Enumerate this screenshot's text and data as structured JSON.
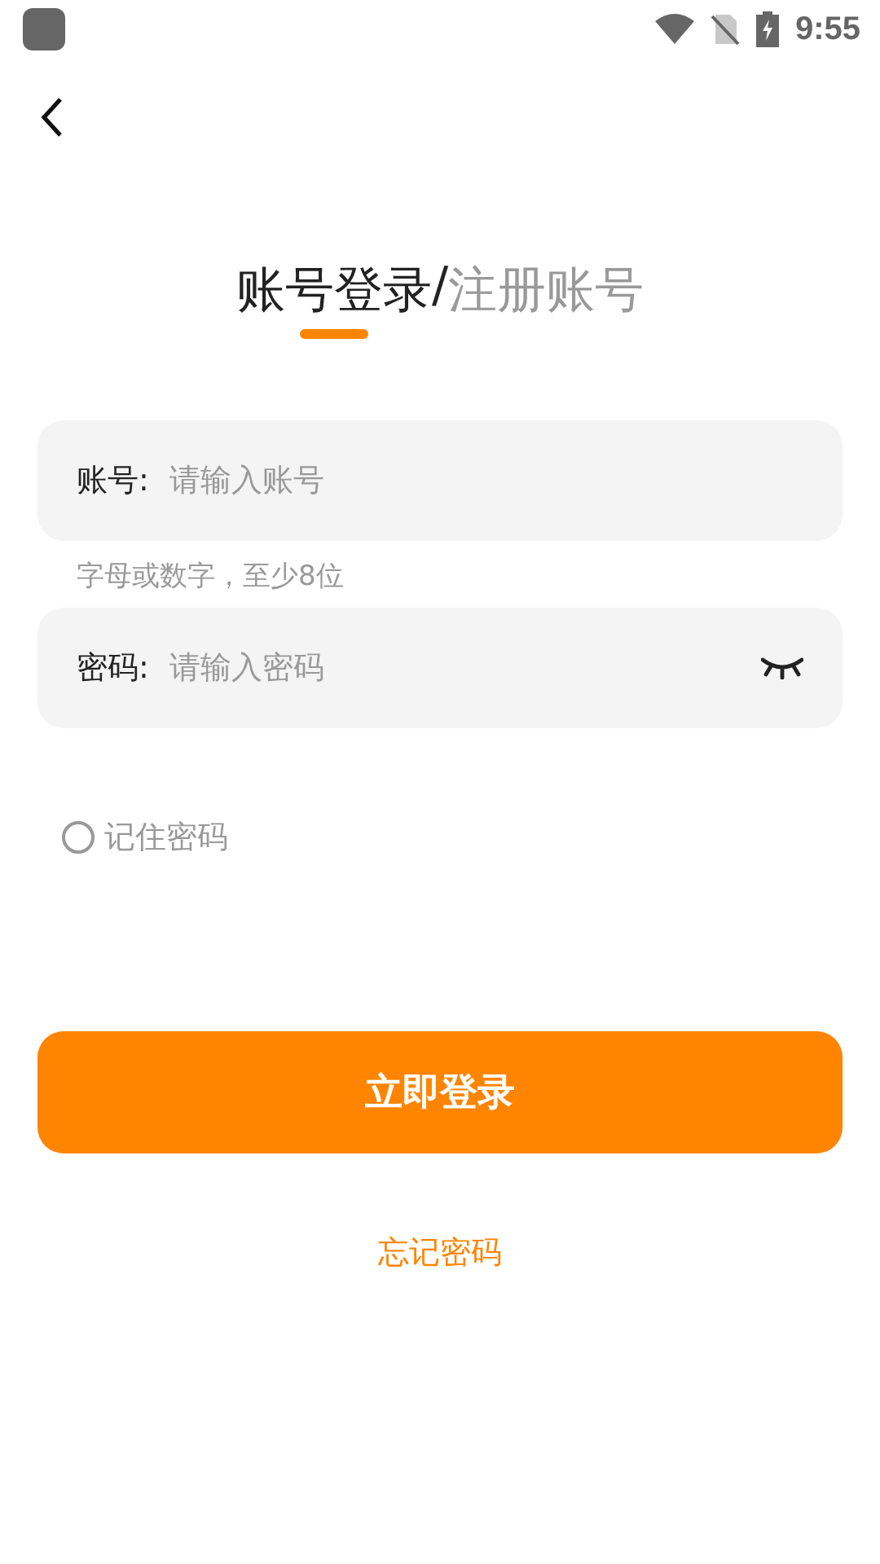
{
  "status_bar": {
    "time": "9:55"
  },
  "tabs": [
    {
      "label": "账号登录",
      "selected": true
    },
    {
      "label": "注册账号",
      "selected": false
    }
  ],
  "tab_separator": "/",
  "fields": [
    {
      "kind": "text",
      "label": "账号:",
      "placeholder": "请输入账号",
      "hint": "字母或数字，至少8位"
    },
    {
      "kind": "password",
      "label": "密码:",
      "placeholder": "请输入密码"
    }
  ],
  "remember": {
    "label": "记住密码",
    "checked": false
  },
  "login_button": "立即登录",
  "forgot_link": "忘记密码"
}
